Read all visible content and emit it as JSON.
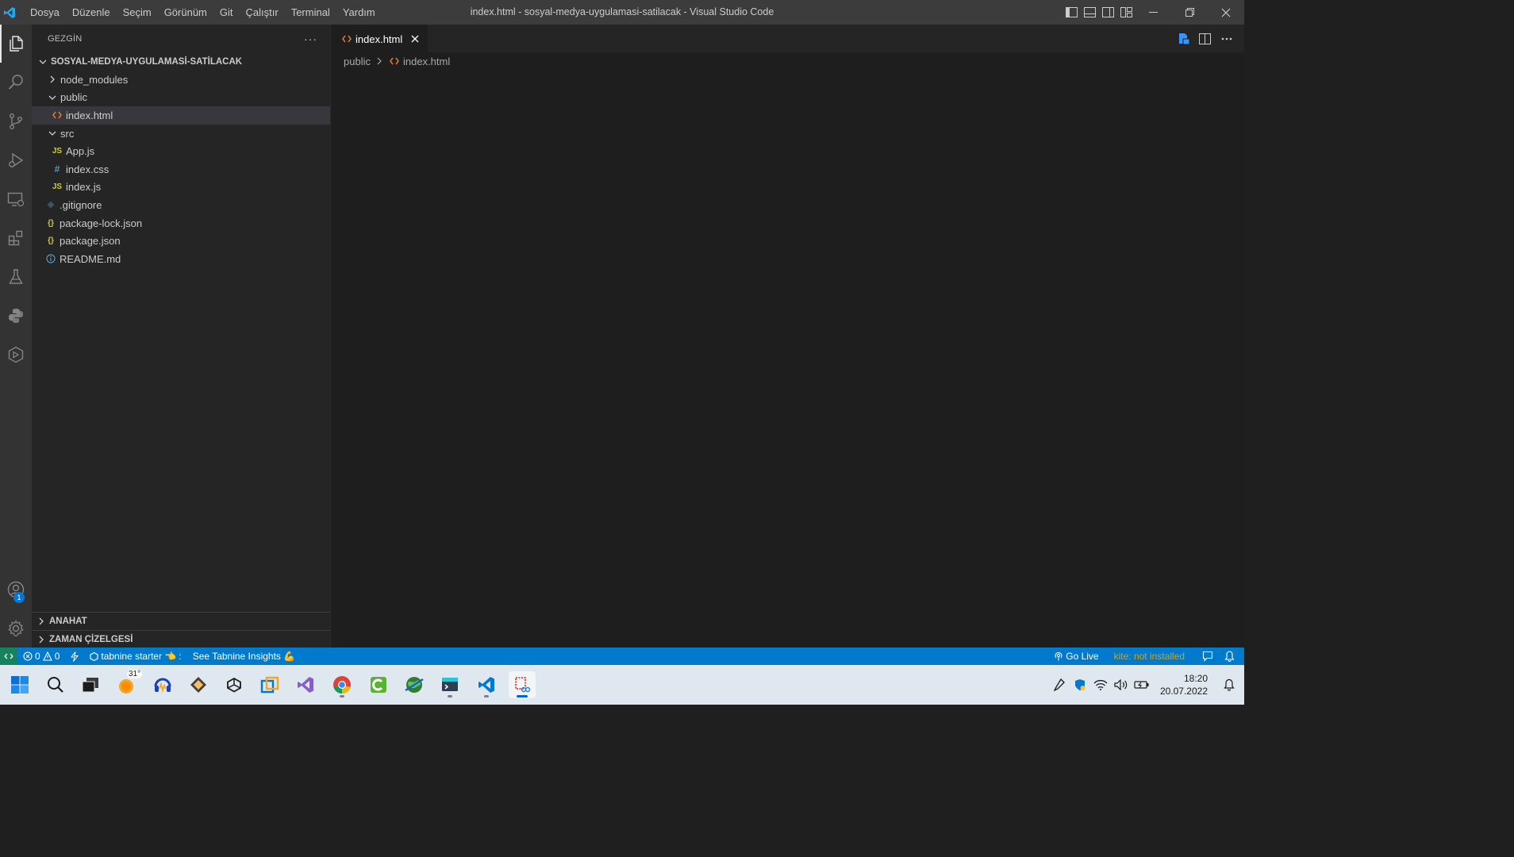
{
  "window": {
    "title": "index.html - sosyal-medya-uygulamasi-satilacak - Visual Studio Code"
  },
  "menu": [
    "Dosya",
    "Düzenle",
    "Seçim",
    "Görünüm",
    "Git",
    "Çalıştır",
    "Terminal",
    "Yardım"
  ],
  "activity_bar": {
    "items": [
      "files-icon",
      "search-icon",
      "source-control-icon",
      "run-debug-icon",
      "remote-explorer-icon",
      "extensions-icon",
      "testing-icon",
      "python-icon",
      "cube-icon"
    ],
    "accounts_badge": "1"
  },
  "sidebar": {
    "header": "GEZGİN",
    "more": "···",
    "project": "SOSYAL-MEDYA-UYGULAMASİ-SATİLACAK",
    "tree": [
      {
        "label": "node_modules",
        "kind": "folder",
        "open": false,
        "depth": 0
      },
      {
        "label": "public",
        "kind": "folder",
        "open": true,
        "depth": 0
      },
      {
        "label": "index.html",
        "kind": "html",
        "depth": 1,
        "selected": true
      },
      {
        "label": "src",
        "kind": "folder",
        "open": true,
        "depth": 0
      },
      {
        "label": "App.js",
        "kind": "js",
        "depth": 1
      },
      {
        "label": "index.css",
        "kind": "css",
        "depth": 1
      },
      {
        "label": "index.js",
        "kind": "js",
        "depth": 1
      },
      {
        "label": ".gitignore",
        "kind": "git",
        "depth": 0
      },
      {
        "label": "package-lock.json",
        "kind": "json",
        "depth": 0
      },
      {
        "label": "package.json",
        "kind": "json",
        "depth": 0
      },
      {
        "label": "README.md",
        "kind": "info",
        "depth": 0
      }
    ],
    "sections": {
      "outline": "ANAHAT",
      "timeline": "ZAMAN ÇİZELGESİ"
    }
  },
  "editor": {
    "tab_label": "index.html",
    "breadcrumb": [
      "public",
      "index.html"
    ]
  },
  "statusbar": {
    "errors": "0",
    "warnings": "0",
    "tabnine": "tabnine starter 👈",
    "tabnine_sep": ":",
    "insights": "See Tabnine Insights 💪",
    "go_live": "Go Live",
    "kite": "kite: not installed"
  },
  "taskbar": {
    "weather_temp": "31°",
    "time": "18:20",
    "date": "20.07.2022"
  },
  "colors": {
    "accent": "#007acc",
    "remote": "#16825d",
    "html_icon": "#e37933",
    "js_icon": "#cbcb41",
    "css_icon": "#519aba",
    "json_icon": "#cbcb41",
    "info_icon": "#519aba",
    "kite": "#d4a017"
  }
}
